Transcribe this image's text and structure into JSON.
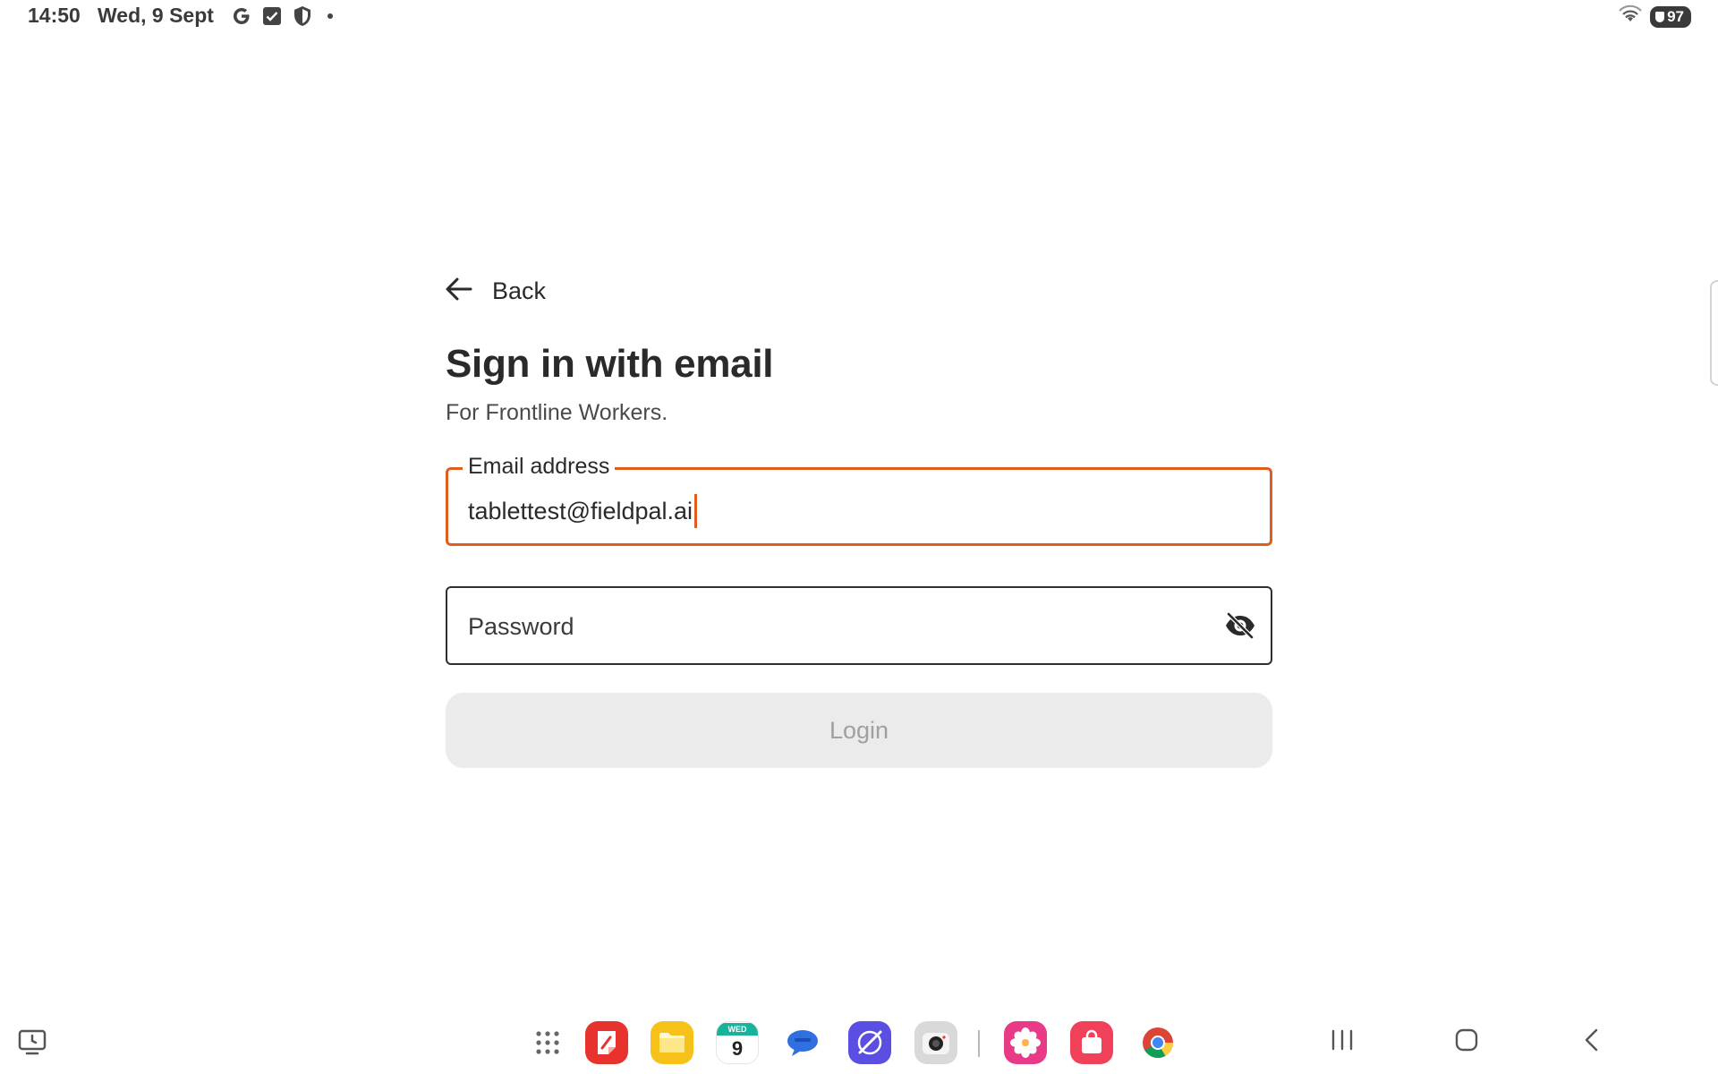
{
  "status_bar": {
    "time": "14:50",
    "date": "Wed, 9 Sept",
    "left_icons": [
      "google-icon",
      "checkbox-icon",
      "shield-icon"
    ],
    "battery": "97",
    "icons_right": [
      "wifi-icon",
      "battery-icon"
    ]
  },
  "form": {
    "back_label": "Back",
    "title": "Sign in with email",
    "subtitle": "For Frontline Workers.",
    "email": {
      "label": "Email address",
      "value": "tablettest@fieldpal.ai"
    },
    "password": {
      "placeholder": "Password",
      "visibility_icon": "eye-off-icon"
    },
    "login_label": "Login"
  },
  "dock": {
    "apps": [
      {
        "name": "app-drawer",
        "icon": "grid-icon"
      },
      {
        "name": "notes",
        "icon": "notes-icon",
        "color": "#e8322e"
      },
      {
        "name": "files",
        "icon": "folder-icon",
        "color": "#f6c21a"
      },
      {
        "name": "calendar",
        "icon": "calendar-icon",
        "day_label": "WED",
        "day_number": "9",
        "color": "#17b39a"
      },
      {
        "name": "messages",
        "icon": "chat-icon",
        "color": "#2f6fe0"
      },
      {
        "name": "internet",
        "icon": "browser-icon",
        "color": "#5b4fe3"
      },
      {
        "name": "camera",
        "icon": "camera-icon",
        "color": "#d9d9d9"
      },
      {
        "name": "gallery",
        "icon": "flower-icon",
        "color": "#e83a86"
      },
      {
        "name": "store",
        "icon": "bag-icon",
        "color": "#f0405a"
      },
      {
        "name": "chrome",
        "icon": "chrome-icon"
      }
    ]
  },
  "nav": {
    "buttons": [
      "recents-icon",
      "home-icon",
      "back-icon"
    ]
  },
  "colors": {
    "accent": "#e05c1f",
    "text": "#2a2a2a",
    "button_disabled_bg": "#ebebeb",
    "button_disabled_text": "#a0a0a0"
  }
}
